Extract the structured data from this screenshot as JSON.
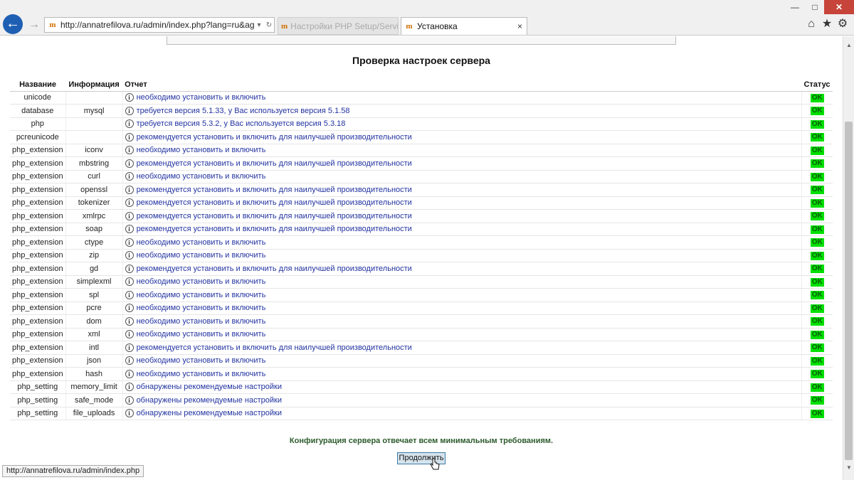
{
  "browser": {
    "address_url": "http://annatrefilova.ru/admin/index.php?lang=ru&agree",
    "favicon_char": "m",
    "tab1_title": "Настройки PHP Setup/Service Install",
    "tab2_title": "Установка",
    "tab_close": "×",
    "back_glyph": "←",
    "fwd_glyph": "→",
    "dropdown_glyph": "▾",
    "refresh_glyph": "↻",
    "home_glyph": "⌂",
    "star_glyph": "★",
    "gear_glyph": "⚙",
    "win_min": "—",
    "win_max": "□",
    "win_close": "✕"
  },
  "page": {
    "title": "Проверка настроек сервера",
    "columns": {
      "name": "Название",
      "info": "Информация",
      "report": "Отчет",
      "status": "Статус"
    },
    "rows": [
      {
        "name": "unicode",
        "info": "",
        "report": "необходимо установить и включить",
        "status": "OK"
      },
      {
        "name": "database",
        "info": "mysql",
        "report": "требуется версия 5.1.33, у Вас используется версия 5.1.58",
        "status": "OK"
      },
      {
        "name": "php",
        "info": "",
        "report": "требуется версия 5.3.2, у Вас используется версия 5.3.18",
        "status": "OK"
      },
      {
        "name": "pcreunicode",
        "info": "",
        "report": "рекомендуется установить и включить для наилучшей производительности",
        "status": "OK"
      },
      {
        "name": "php_extension",
        "info": "iconv",
        "report": "необходимо установить и включить",
        "status": "OK"
      },
      {
        "name": "php_extension",
        "info": "mbstring",
        "report": "рекомендуется установить и включить для наилучшей производительности",
        "status": "OK"
      },
      {
        "name": "php_extension",
        "info": "curl",
        "report": "необходимо установить и включить",
        "status": "OK"
      },
      {
        "name": "php_extension",
        "info": "openssl",
        "report": "рекомендуется установить и включить для наилучшей производительности",
        "status": "OK"
      },
      {
        "name": "php_extension",
        "info": "tokenizer",
        "report": "рекомендуется установить и включить для наилучшей производительности",
        "status": "OK"
      },
      {
        "name": "php_extension",
        "info": "xmlrpc",
        "report": "рекомендуется установить и включить для наилучшей производительности",
        "status": "OK"
      },
      {
        "name": "php_extension",
        "info": "soap",
        "report": "рекомендуется установить и включить для наилучшей производительности",
        "status": "OK"
      },
      {
        "name": "php_extension",
        "info": "ctype",
        "report": "необходимо установить и включить",
        "status": "OK"
      },
      {
        "name": "php_extension",
        "info": "zip",
        "report": "необходимо установить и включить",
        "status": "OK"
      },
      {
        "name": "php_extension",
        "info": "gd",
        "report": "рекомендуется установить и включить для наилучшей производительности",
        "status": "OK"
      },
      {
        "name": "php_extension",
        "info": "simplexml",
        "report": "необходимо установить и включить",
        "status": "OK"
      },
      {
        "name": "php_extension",
        "info": "spl",
        "report": "необходимо установить и включить",
        "status": "OK"
      },
      {
        "name": "php_extension",
        "info": "pcre",
        "report": "необходимо установить и включить",
        "status": "OK"
      },
      {
        "name": "php_extension",
        "info": "dom",
        "report": "необходимо установить и включить",
        "status": "OK"
      },
      {
        "name": "php_extension",
        "info": "xml",
        "report": "необходимо установить и включить",
        "status": "OK"
      },
      {
        "name": "php_extension",
        "info": "intl",
        "report": "рекомендуется установить и включить для наилучшей производительности",
        "status": "OK"
      },
      {
        "name": "php_extension",
        "info": "json",
        "report": "необходимо установить и включить",
        "status": "OK"
      },
      {
        "name": "php_extension",
        "info": "hash",
        "report": "необходимо установить и включить",
        "status": "OK"
      },
      {
        "name": "php_setting",
        "info": "memory_limit",
        "report": "обнаружены рекомендуемые настройки",
        "status": "OK"
      },
      {
        "name": "php_setting",
        "info": "safe_mode",
        "report": "обнаружены рекомендуемые настройки",
        "status": "OK"
      },
      {
        "name": "php_setting",
        "info": "file_uploads",
        "report": "обнаружены рекомендуемые настройки",
        "status": "OK"
      }
    ],
    "info_glyph": "i",
    "confirmation": "Конфигурация сервера отвечает всем минимальным требованиям.",
    "continue_label": "Продолжить",
    "status_bar_url": "http://annatrefilova.ru/admin/index.php"
  },
  "colors": {
    "ok_bg": "#00e000",
    "link": "#2233a0",
    "back_button": "#1e5fb3"
  }
}
